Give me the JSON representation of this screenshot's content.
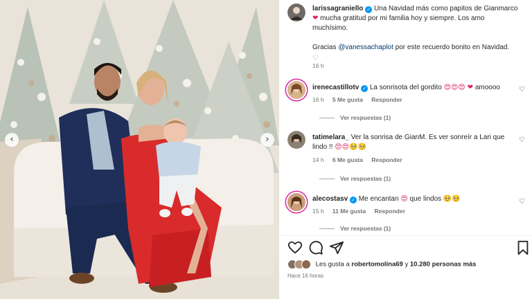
{
  "post": {
    "author": "larissagraniello",
    "caption_line1": "Una Navidad más como papitos de Gianmarco",
    "caption_line2": "mucha gratitud por mi familia hoy y siempre. Los amo",
    "caption_line3": "muchísimo.",
    "caption_thanks_pre": "Gracias",
    "caption_mention": "@vanessachaplot",
    "caption_thanks_post": "por este recuerdo bonito en Navidad.",
    "caption_time": "16 h"
  },
  "comments": [
    {
      "user": "irenecastillotv",
      "verified": true,
      "text": "La sonrisota del gordito",
      "emoji": "😍😍😍",
      "heart": "❤",
      "tail": "amoooo",
      "time": "16 h",
      "likes": "5 Me gusta",
      "reply": "Responder",
      "view_replies": "Ver respuestas (1)"
    },
    {
      "user": "tatimelara_",
      "verified": false,
      "text": "Ver la sonrisa de GianM. Es ver sonreír a Lari que",
      "text2": "lindo !!",
      "emoji": "😍😍🥺🥺",
      "time": "14 h",
      "likes": "6 Me gusta",
      "reply": "Responder",
      "view_replies": "Ver respuestas (1)"
    },
    {
      "user": "alecostasv",
      "verified": true,
      "text": "Me encantan",
      "emoji": "😍",
      "tail": "que lindos",
      "emoji2": "🥺🥺",
      "time": "15 h",
      "likes": "11 Me gusta",
      "reply": "Responder",
      "view_replies": "Ver respuestas (1)"
    }
  ],
  "likes": {
    "prefix": "Les gusta a",
    "user": "robertomolina69",
    "middle": "y",
    "count": "10.280 personas más"
  },
  "time_ago": "Hace 16 horas",
  "icons": {
    "like": "heart-outline-icon",
    "comment": "comment-bubble-icon",
    "share": "paper-plane-icon",
    "save": "bookmark-icon",
    "prev": "chevron-left-icon",
    "next": "chevron-right-icon"
  },
  "colors": {
    "verified": "#0095f6",
    "mention": "#00376b",
    "dress": "#d92b2b",
    "suit": "#1f2f5a"
  }
}
